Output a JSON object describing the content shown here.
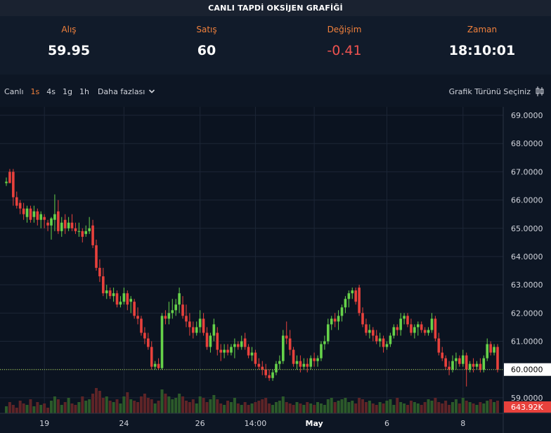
{
  "title": "CANLI TAPDİ OKSİJEN GRAFİĞİ",
  "ticker": {
    "bid_label": "Alış",
    "bid_value": "59.95",
    "ask_label": "Satış",
    "ask_value": "60",
    "change_label": "Değişim",
    "change_value": "-0.41",
    "time_label": "Zaman",
    "time_value": "18:10:01"
  },
  "toolbar": {
    "live": "Canlı",
    "intervals": [
      "1s",
      "4s",
      "1g",
      "1h"
    ],
    "active_interval": "1s",
    "more": "Daha fazlası",
    "chart_type": "Grafik Türünü Seçiniz"
  },
  "colors": {
    "up": "#66d24a",
    "down": "#e8413c",
    "accent": "#f0803c",
    "price_line": "#b5e04a"
  },
  "chart_data": {
    "type": "candlestick",
    "y_ticks": [
      "69.0000",
      "68.0000",
      "67.0000",
      "66.0000",
      "65.0000",
      "64.0000",
      "63.0000",
      "62.0000",
      "61.0000",
      "60.0000",
      "59.0000"
    ],
    "ylim": [
      58.45,
      69.3
    ],
    "x_ticks": [
      {
        "label": "19",
        "index": 11
      },
      {
        "label": "24",
        "index": 34
      },
      {
        "label": "26",
        "index": 56
      },
      {
        "label": "14:00",
        "index": 72
      },
      {
        "label": "May",
        "index": 89
      },
      {
        "label": "6",
        "index": 110
      },
      {
        "label": "8",
        "index": 132
      }
    ],
    "last_price": "60.0000",
    "last_volume": "643.92K",
    "grid": true,
    "candles": [
      [
        66.6,
        66.8,
        66.5,
        66.65
      ],
      [
        67.0,
        67.1,
        66.6,
        66.6
      ],
      [
        67.0,
        67.1,
        65.8,
        66.1
      ],
      [
        66.1,
        66.3,
        65.7,
        65.8
      ],
      [
        65.9,
        66.0,
        65.5,
        65.7
      ],
      [
        65.7,
        65.9,
        65.3,
        65.5
      ],
      [
        65.4,
        65.8,
        65.2,
        65.7
      ],
      [
        65.7,
        65.8,
        65.2,
        65.3
      ],
      [
        65.4,
        65.8,
        65.2,
        65.6
      ],
      [
        65.6,
        65.7,
        65.1,
        65.3
      ],
      [
        65.3,
        65.6,
        65.0,
        65.5
      ],
      [
        65.4,
        65.5,
        65.0,
        65.3
      ],
      [
        65.2,
        65.3,
        64.9,
        65.1
      ],
      [
        65.1,
        65.4,
        64.6,
        65.35
      ],
      [
        65.3,
        66.2,
        64.9,
        65.5
      ],
      [
        65.6,
        66.0,
        64.8,
        64.9
      ],
      [
        64.9,
        65.4,
        64.7,
        65.2
      ],
      [
        65.3,
        65.5,
        64.8,
        65.0
      ],
      [
        65.0,
        65.4,
        64.9,
        65.2
      ],
      [
        65.2,
        65.5,
        64.9,
        65.0
      ],
      [
        65.0,
        65.2,
        64.8,
        64.9
      ],
      [
        64.9,
        65.2,
        64.7,
        64.9
      ],
      [
        64.9,
        65.0,
        64.5,
        64.7
      ],
      [
        64.8,
        65.1,
        64.7,
        64.9
      ],
      [
        64.9,
        65.4,
        64.8,
        65.0
      ],
      [
        65.1,
        65.3,
        64.3,
        64.4
      ],
      [
        64.4,
        64.6,
        63.5,
        63.6
      ],
      [
        63.6,
        63.9,
        63.1,
        63.3
      ],
      [
        63.3,
        63.6,
        62.6,
        62.7
      ],
      [
        62.7,
        63.0,
        62.5,
        62.8
      ],
      [
        62.8,
        62.9,
        62.5,
        62.6
      ],
      [
        62.6,
        62.9,
        62.4,
        62.7
      ],
      [
        62.7,
        62.8,
        62.2,
        62.3
      ],
      [
        62.3,
        62.6,
        62.2,
        62.4
      ],
      [
        62.4,
        62.9,
        62.3,
        62.7
      ],
      [
        62.7,
        62.8,
        62.1,
        62.3
      ],
      [
        62.4,
        62.6,
        62.0,
        62.5
      ],
      [
        62.4,
        62.5,
        61.8,
        61.9
      ],
      [
        61.9,
        62.2,
        61.6,
        61.8
      ],
      [
        61.8,
        61.9,
        61.2,
        61.3
      ],
      [
        61.3,
        61.5,
        60.9,
        61.1
      ],
      [
        61.1,
        61.3,
        60.7,
        60.8
      ],
      [
        60.8,
        61.0,
        60.0,
        60.1
      ],
      [
        60.1,
        60.3,
        60.0,
        60.2
      ],
      [
        60.2,
        60.4,
        60.0,
        60.05
      ],
      [
        60.05,
        62.0,
        60.0,
        61.9
      ],
      [
        61.9,
        62.1,
        61.6,
        61.8
      ],
      [
        61.8,
        62.4,
        61.6,
        62.0
      ],
      [
        62.0,
        62.5,
        61.8,
        62.1
      ],
      [
        62.1,
        62.5,
        61.9,
        62.3
      ],
      [
        62.3,
        62.9,
        62.0,
        62.7
      ],
      [
        62.3,
        62.6,
        61.8,
        61.9
      ],
      [
        61.9,
        62.3,
        61.5,
        61.7
      ],
      [
        61.7,
        62.0,
        61.2,
        61.5
      ],
      [
        61.5,
        61.7,
        61.1,
        61.3
      ],
      [
        61.3,
        61.7,
        61.2,
        61.5
      ],
      [
        61.5,
        62.1,
        61.3,
        61.8
      ],
      [
        61.8,
        62.0,
        61.2,
        61.3
      ],
      [
        61.3,
        61.5,
        60.7,
        60.8
      ],
      [
        60.8,
        61.3,
        60.6,
        61.2
      ],
      [
        61.2,
        61.8,
        61.0,
        61.6
      ],
      [
        61.3,
        61.5,
        60.5,
        60.7
      ],
      [
        60.7,
        60.9,
        60.3,
        60.6
      ],
      [
        60.6,
        60.9,
        60.4,
        60.7
      ],
      [
        60.7,
        60.9,
        60.5,
        60.6
      ],
      [
        60.6,
        60.9,
        60.5,
        60.8
      ],
      [
        60.8,
        61.1,
        60.4,
        60.9
      ],
      [
        60.9,
        61.0,
        60.7,
        60.8
      ],
      [
        60.8,
        61.2,
        60.7,
        61.0
      ],
      [
        61.1,
        61.3,
        60.7,
        60.8
      ],
      [
        60.8,
        60.9,
        60.4,
        60.5
      ],
      [
        60.5,
        60.8,
        60.3,
        60.6
      ],
      [
        60.6,
        60.7,
        60.1,
        60.2
      ],
      [
        60.2,
        60.4,
        60.0,
        60.1
      ],
      [
        60.1,
        60.3,
        59.8,
        60.0
      ],
      [
        60.0,
        60.2,
        59.7,
        59.8
      ],
      [
        59.8,
        60.0,
        59.6,
        59.7
      ],
      [
        59.7,
        60.0,
        59.6,
        59.9
      ],
      [
        59.9,
        60.3,
        59.8,
        60.2
      ],
      [
        60.2,
        60.5,
        60.0,
        60.3
      ],
      [
        60.3,
        61.4,
        60.2,
        61.2
      ],
      [
        61.2,
        61.7,
        60.9,
        61.1
      ],
      [
        61.1,
        61.4,
        60.5,
        60.7
      ],
      [
        60.7,
        60.8,
        60.1,
        60.2
      ],
      [
        60.2,
        60.5,
        60.0,
        60.3
      ],
      [
        60.3,
        60.5,
        59.9,
        60.1
      ],
      [
        60.1,
        60.4,
        60.0,
        60.2
      ],
      [
        60.2,
        60.4,
        59.9,
        60.1
      ],
      [
        60.1,
        60.5,
        60.0,
        60.4
      ],
      [
        60.4,
        60.6,
        60.1,
        60.3
      ],
      [
        60.3,
        60.5,
        60.1,
        60.4
      ],
      [
        60.4,
        61.0,
        60.3,
        60.9
      ],
      [
        60.9,
        61.2,
        60.7,
        61.0
      ],
      [
        61.0,
        61.8,
        60.9,
        61.6
      ],
      [
        61.6,
        61.9,
        61.4,
        61.8
      ],
      [
        61.8,
        62.0,
        61.5,
        61.7
      ],
      [
        61.7,
        62.1,
        61.4,
        61.9
      ],
      [
        61.9,
        62.3,
        61.7,
        62.2
      ],
      [
        62.2,
        62.6,
        62.0,
        62.5
      ],
      [
        62.5,
        62.8,
        62.2,
        62.7
      ],
      [
        62.7,
        62.9,
        62.5,
        62.8
      ],
      [
        62.8,
        62.9,
        62.3,
        62.4
      ],
      [
        62.9,
        63.0,
        61.9,
        62.0
      ],
      [
        62.0,
        62.2,
        61.5,
        61.6
      ],
      [
        61.6,
        61.8,
        61.2,
        61.3
      ],
      [
        61.3,
        61.6,
        61.1,
        61.4
      ],
      [
        61.4,
        61.5,
        61.0,
        61.2
      ],
      [
        61.2,
        61.4,
        60.9,
        61.0
      ],
      [
        61.0,
        61.3,
        60.8,
        61.1
      ],
      [
        61.1,
        61.2,
        60.6,
        60.8
      ],
      [
        60.8,
        61.0,
        60.7,
        60.9
      ],
      [
        60.9,
        61.3,
        60.8,
        61.2
      ],
      [
        61.2,
        61.6,
        61.1,
        61.5
      ],
      [
        61.5,
        61.6,
        61.2,
        61.4
      ],
      [
        61.4,
        62.0,
        61.2,
        61.8
      ],
      [
        61.8,
        62.0,
        61.6,
        61.9
      ],
      [
        61.9,
        62.0,
        61.5,
        61.6
      ],
      [
        61.6,
        61.8,
        61.2,
        61.3
      ],
      [
        61.3,
        61.6,
        61.1,
        61.5
      ],
      [
        61.5,
        61.7,
        61.2,
        61.6
      ],
      [
        61.6,
        61.7,
        61.3,
        61.4
      ],
      [
        61.4,
        61.5,
        61.2,
        61.3
      ],
      [
        61.3,
        61.5,
        61.2,
        61.4
      ],
      [
        61.4,
        62.0,
        61.3,
        61.8
      ],
      [
        61.8,
        61.9,
        61.0,
        61.1
      ],
      [
        61.1,
        61.3,
        60.5,
        60.6
      ],
      [
        60.6,
        60.8,
        60.3,
        60.4
      ],
      [
        60.4,
        60.5,
        60.0,
        60.1
      ],
      [
        60.1,
        60.3,
        59.8,
        60.0
      ],
      [
        60.0,
        60.5,
        59.9,
        60.3
      ],
      [
        60.3,
        60.6,
        60.0,
        60.4
      ],
      [
        60.4,
        60.5,
        60.1,
        60.2
      ],
      [
        60.2,
        60.7,
        60.1,
        60.5
      ],
      [
        60.5,
        60.6,
        59.4,
        60.0
      ],
      [
        60.0,
        60.3,
        59.9,
        60.2
      ],
      [
        60.2,
        60.4,
        59.9,
        60.1
      ],
      [
        60.1,
        60.3,
        60.0,
        60.2
      ],
      [
        60.2,
        60.4,
        59.9,
        60.0
      ],
      [
        60.0,
        60.5,
        59.9,
        60.4
      ],
      [
        60.4,
        61.1,
        60.3,
        60.9
      ],
      [
        60.9,
        61.0,
        60.5,
        60.6
      ],
      [
        60.6,
        60.9,
        60.5,
        60.8
      ],
      [
        60.8,
        60.9,
        59.9,
        60.0
      ]
    ],
    "volumes": [
      0.25,
      0.4,
      0.3,
      0.2,
      0.45,
      0.35,
      0.3,
      0.5,
      0.25,
      0.4,
      0.3,
      0.35,
      0.2,
      0.45,
      0.6,
      0.5,
      0.3,
      0.4,
      0.55,
      0.35,
      0.3,
      0.4,
      0.6,
      0.45,
      0.5,
      0.7,
      0.9,
      0.8,
      0.55,
      0.6,
      0.45,
      0.4,
      0.5,
      0.35,
      0.6,
      0.75,
      0.5,
      0.45,
      0.4,
      0.6,
      0.7,
      0.55,
      0.5,
      0.35,
      0.45,
      0.85,
      0.7,
      0.6,
      0.5,
      0.55,
      0.7,
      0.6,
      0.45,
      0.4,
      0.5,
      0.35,
      0.6,
      0.55,
      0.4,
      0.5,
      0.65,
      0.5,
      0.35,
      0.3,
      0.45,
      0.4,
      0.55,
      0.35,
      0.3,
      0.4,
      0.3,
      0.35,
      0.4,
      0.45,
      0.5,
      0.55,
      0.35,
      0.3,
      0.4,
      0.45,
      0.6,
      0.4,
      0.35,
      0.3,
      0.4,
      0.35,
      0.3,
      0.4,
      0.35,
      0.3,
      0.4,
      0.35,
      0.3,
      0.5,
      0.55,
      0.4,
      0.45,
      0.5,
      0.55,
      0.4,
      0.45,
      0.35,
      0.55,
      0.5,
      0.4,
      0.45,
      0.35,
      0.3,
      0.4,
      0.35,
      0.45,
      0.5,
      0.3,
      0.55,
      0.4,
      0.35,
      0.3,
      0.45,
      0.4,
      0.35,
      0.3,
      0.4,
      0.5,
      0.45,
      0.55,
      0.4,
      0.35,
      0.45,
      0.3,
      0.4,
      0.5,
      0.35,
      0.55,
      0.45,
      0.4,
      0.35,
      0.3,
      0.4,
      0.35,
      0.45,
      0.5,
      0.4,
      0.45
    ]
  }
}
